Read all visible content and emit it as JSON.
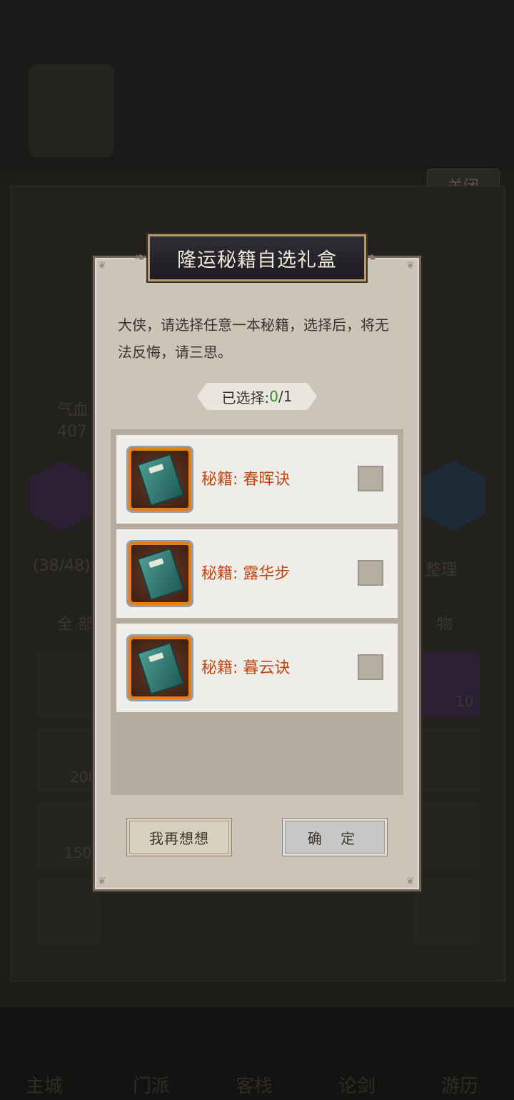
{
  "background": {
    "close_label": "关闭",
    "hp_label": "气血",
    "hp_value": "407",
    "bag_count": "(38/48)",
    "sort_label": "整理",
    "filter_all": "全 部",
    "filter_items": "物",
    "nav_labels": [
      "主城",
      "门派",
      "客栈",
      "论剑",
      "游历"
    ],
    "stack_counts": [
      "10",
      "200",
      "150"
    ]
  },
  "dialog": {
    "title": "隆运秘籍自选礼盒",
    "description": "大侠，请选择任意一本秘籍，选择后，将无法反悔，请三思。",
    "counter_label": "已选择:",
    "counter_selected": "0",
    "counter_total": "/1",
    "items": [
      {
        "name": "秘籍: 春晖诀",
        "icon": "scroll-book-icon",
        "checked": false
      },
      {
        "name": "秘籍: 露华步",
        "icon": "scroll-book-icon",
        "checked": false
      },
      {
        "name": "秘籍: 暮云诀",
        "icon": "scroll-book-icon",
        "checked": false
      }
    ],
    "cancel_label": "我再想想",
    "confirm_label": "确 定"
  },
  "colors": {
    "accent_orange": "#c04a12",
    "counter_green": "#3a8a24",
    "dialog_bg": "#cdc4b9"
  }
}
